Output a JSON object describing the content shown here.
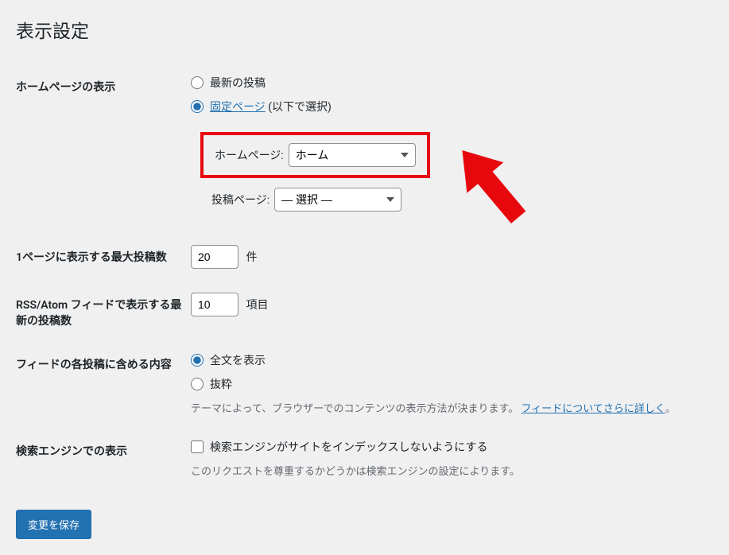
{
  "page_title": "表示設定",
  "homepage": {
    "label": "ホームページの表示",
    "option_latest": "最新の投稿",
    "option_static_link": "固定ページ",
    "option_static_suffix": " (以下で選択)",
    "homepage_select_label": "ホームページ:",
    "homepage_select_value": "ホーム",
    "posts_page_label": "投稿ページ:",
    "posts_page_value": "— 選択 —"
  },
  "posts_per_page": {
    "label": "1ページに表示する最大投稿数",
    "value": "20",
    "unit": "件"
  },
  "rss_items": {
    "label": "RSS/Atom フィードで表示する最新の投稿数",
    "value": "10",
    "unit": "項目"
  },
  "feed_content": {
    "label": "フィードの各投稿に含める内容",
    "option_full": "全文を表示",
    "option_excerpt": "抜粋",
    "description_prefix": "テーマによって、ブラウザーでのコンテンツの表示方法が決まります。",
    "description_link": "フィードについてさらに詳しく",
    "description_suffix": "。"
  },
  "search_engine": {
    "label": "検索エンジンでの表示",
    "checkbox_label": "検索エンジンがサイトをインデックスしないようにする",
    "description": "このリクエストを尊重するかどうかは検索エンジンの設定によります。"
  },
  "submit_label": "変更を保存"
}
